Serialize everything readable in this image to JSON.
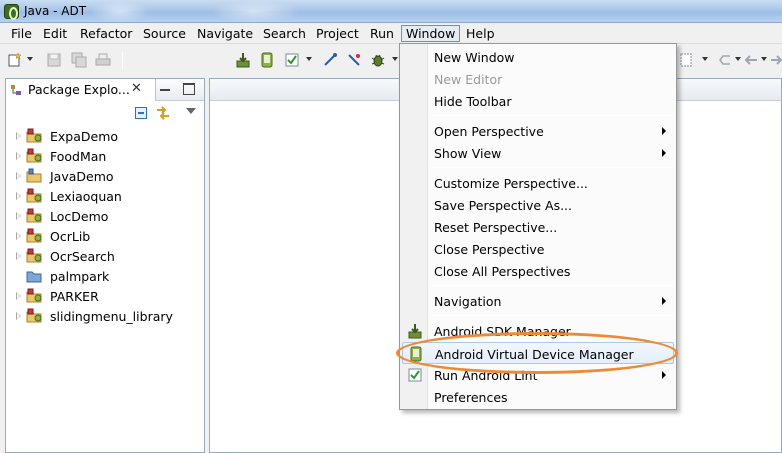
{
  "window": {
    "title": "Java - ADT"
  },
  "menubar": {
    "items": [
      "File",
      "Edit",
      "Refactor",
      "Source",
      "Navigate",
      "Search",
      "Project",
      "Run",
      "Window",
      "Help"
    ],
    "open_menu": "Window"
  },
  "package_explorer": {
    "tab_label": "Package Explo...",
    "close_glyph": "✕",
    "projects": [
      {
        "name": "ExpaDemo",
        "expandable": true,
        "icon": "android-project-icon"
      },
      {
        "name": "FoodMan",
        "expandable": true,
        "icon": "android-project-icon"
      },
      {
        "name": "JavaDemo",
        "expandable": true,
        "icon": "java-project-icon"
      },
      {
        "name": "Lexiaoquan",
        "expandable": true,
        "icon": "android-project-icon"
      },
      {
        "name": "LocDemo",
        "expandable": true,
        "icon": "android-project-icon"
      },
      {
        "name": "OcrLib",
        "expandable": true,
        "icon": "android-project-icon"
      },
      {
        "name": "OcrSearch",
        "expandable": true,
        "icon": "android-project-icon"
      },
      {
        "name": "palmpark",
        "expandable": false,
        "icon": "closed-project-icon"
      },
      {
        "name": "PARKER",
        "expandable": true,
        "icon": "android-project-icon"
      },
      {
        "name": "slidingmenu_library",
        "expandable": true,
        "icon": "android-project-icon"
      }
    ]
  },
  "window_menu": {
    "items": [
      {
        "label": "New Window",
        "disabled": false,
        "submenu": false
      },
      {
        "label": "New Editor",
        "disabled": true,
        "submenu": false
      },
      {
        "label": "Hide Toolbar",
        "disabled": false,
        "submenu": false
      },
      {
        "label": "Open Perspective",
        "disabled": false,
        "submenu": true
      },
      {
        "label": "Show View",
        "disabled": false,
        "submenu": true
      },
      {
        "label": "Customize Perspective...",
        "disabled": false,
        "submenu": false
      },
      {
        "label": "Save Perspective As...",
        "disabled": false,
        "submenu": false
      },
      {
        "label": "Reset Perspective...",
        "disabled": false,
        "submenu": false
      },
      {
        "label": "Close Perspective",
        "disabled": false,
        "submenu": false
      },
      {
        "label": "Close All Perspectives",
        "disabled": false,
        "submenu": false
      },
      {
        "label": "Navigation",
        "disabled": false,
        "submenu": true
      },
      {
        "label": "Android SDK Manager",
        "disabled": false,
        "submenu": false,
        "icon": "sdk-download-icon"
      },
      {
        "label": "Android Virtual Device Manager",
        "disabled": false,
        "submenu": false,
        "icon": "avd-phone-icon",
        "highlighted": true
      },
      {
        "label": "Run Android Lint",
        "disabled": false,
        "submenu": true,
        "icon": "lint-check-icon"
      },
      {
        "label": "Preferences",
        "disabled": false,
        "submenu": false
      }
    ]
  },
  "colors": {
    "annotation": "#ee8a35",
    "highlight_border": "#a8c8ec",
    "disabled_text": "#9a9a9a"
  }
}
